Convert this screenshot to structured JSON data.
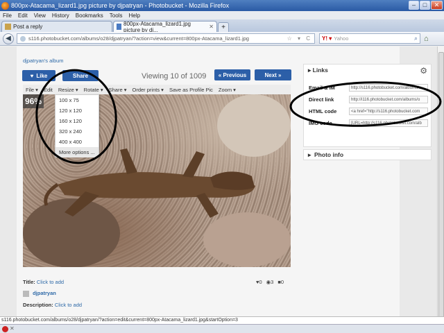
{
  "window": {
    "title": "800px-Atacama_lizard1.jpg picture by djpatryan - Photobucket - Mozilla Firefox"
  },
  "menu": [
    "File",
    "Edit",
    "View",
    "History",
    "Bookmarks",
    "Tools",
    "Help"
  ],
  "tabs": [
    {
      "label": "Post a reply"
    },
    {
      "label": "800px-Atacama_lizard1.jpg picture by dj..."
    }
  ],
  "nav": {
    "url": "s116.photobucket.com/albums/o28/djpatryan/?action=view&current=800px-Atacama_lizard1.jpg",
    "search_placeholder": "Yahoo"
  },
  "page": {
    "album_link": "djpatryan's album",
    "like_label": "Like",
    "share_label": "Share",
    "viewing_text": "Viewing 10 of 1009",
    "prev_label": "« Previous",
    "next_label": "Next »",
    "toolbar": [
      "File ▾",
      "Edit",
      "Resize ▾",
      "Rotate ▾",
      "Share ▾",
      "Order prints ▾",
      "Save as Profile Pic",
      "Zoom ▾"
    ],
    "zoom_pct": "96%",
    "resize_options": [
      "100 x 75",
      "120 x 120",
      "160 x 120",
      "320 x 240",
      "400 x 400",
      "More options ..."
    ],
    "title_label": "Title:",
    "title_link": "Click to add",
    "owner": "djpatryan",
    "description_label": "Description:",
    "description_link": "Click to add",
    "likes": "0",
    "views": "3",
    "comments": "0"
  },
  "links_panel": {
    "heading": "Links",
    "rows": [
      {
        "label": "Email & IM",
        "value": "http://s116.photobucket.com/albums/o"
      },
      {
        "label": "Direct link",
        "value": "http://i116.photobucket.com/albums/o"
      },
      {
        "label": "HTML code",
        "value": "<a href=\"http://s116.photobucket.com"
      },
      {
        "label": "IMG code",
        "value": "[URL=http://s116.photobucket.com/alb"
      }
    ]
  },
  "photo_info_panel": {
    "heading": "Photo info"
  },
  "status": {
    "text": "s116.photobucket.com/albums/o28/djpatryan/?action=edit&current=800px-Atacama_lizard1.jpg&startOption=3"
  },
  "colors": {
    "accent": "#2c5fa8",
    "link": "#2f6aa8"
  }
}
